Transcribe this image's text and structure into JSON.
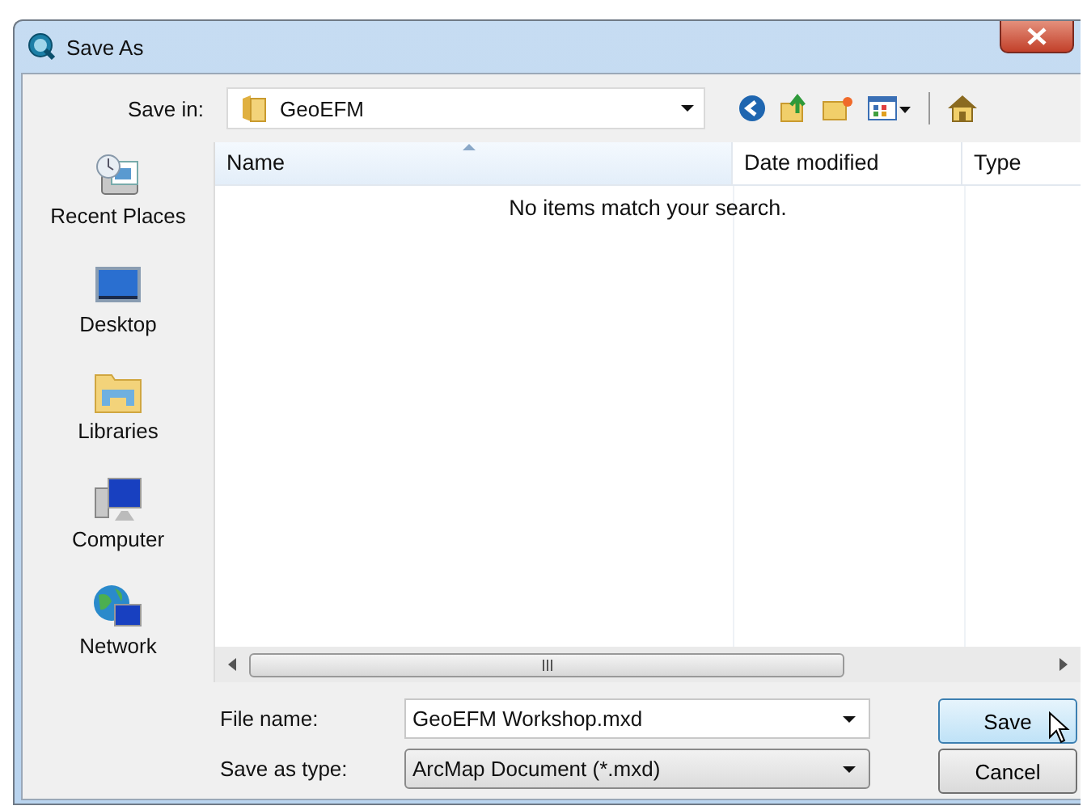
{
  "window": {
    "title": "Save As"
  },
  "save_in": {
    "label": "Save in:",
    "value": "GeoEFM"
  },
  "places": [
    {
      "label": "Recent Places",
      "kind": "recent"
    },
    {
      "label": "Desktop",
      "kind": "desktop"
    },
    {
      "label": "Libraries",
      "kind": "libraries"
    },
    {
      "label": "Computer",
      "kind": "computer"
    },
    {
      "label": "Network",
      "kind": "network"
    }
  ],
  "table": {
    "columns": [
      {
        "label": "Name",
        "sorted": true
      },
      {
        "label": "Date modified",
        "sorted": false
      },
      {
        "label": "Type",
        "sorted": false
      }
    ],
    "empty_message": "No items match your search."
  },
  "file_name": {
    "label": "File name:",
    "value": "GeoEFM Workshop.mxd"
  },
  "save_as_type": {
    "label": "Save as type:",
    "value": "ArcMap Document (*.mxd)"
  },
  "buttons": [
    {
      "label": "Save",
      "default": true
    },
    {
      "label": "Cancel",
      "default": false
    }
  ]
}
